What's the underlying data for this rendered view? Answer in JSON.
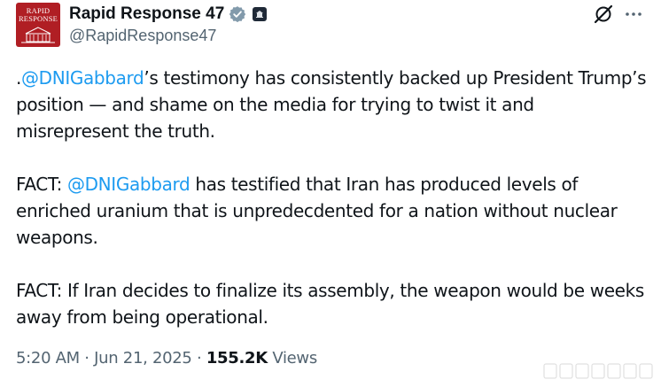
{
  "author": {
    "display_name": "Rapid Response 47",
    "handle": "@RapidResponse47",
    "avatar_text_line1": "RAPID",
    "avatar_text_line2": "RESPONSE",
    "verified_icon": "verified-badge-icon",
    "affiliate_icon": "white-house-affiliate-icon"
  },
  "header_actions": {
    "grok_icon": "grok-icon",
    "more_icon": "more-options-icon"
  },
  "tweet": {
    "p1_prefix": ".",
    "p1_mention": "@DNIGabbard",
    "p1_rest": "’s testimony has consistently backed up President Trump’s position — and shame on the media for trying to twist it and misrepresent the truth.",
    "p2_prefix": "FACT: ",
    "p2_mention": "@DNIGabbard",
    "p2_rest": " has testified that Iran has produced levels of enriched uranium that is unpredecdented for a nation without nuclear weapons.",
    "p3": "FACT: If Iran decides to finalize its assembly, the weapon would be weeks away from being operational."
  },
  "meta": {
    "time": "5:20 AM",
    "separator": " · ",
    "date": "Jun 21, 2025",
    "views_count": "155.2K",
    "views_label": " Views"
  },
  "colors": {
    "text": "#0f1419",
    "secondary": "#536471",
    "link": "#1d9bf0",
    "avatar_red": "#b01e24",
    "verified_gold": "#829aab"
  }
}
